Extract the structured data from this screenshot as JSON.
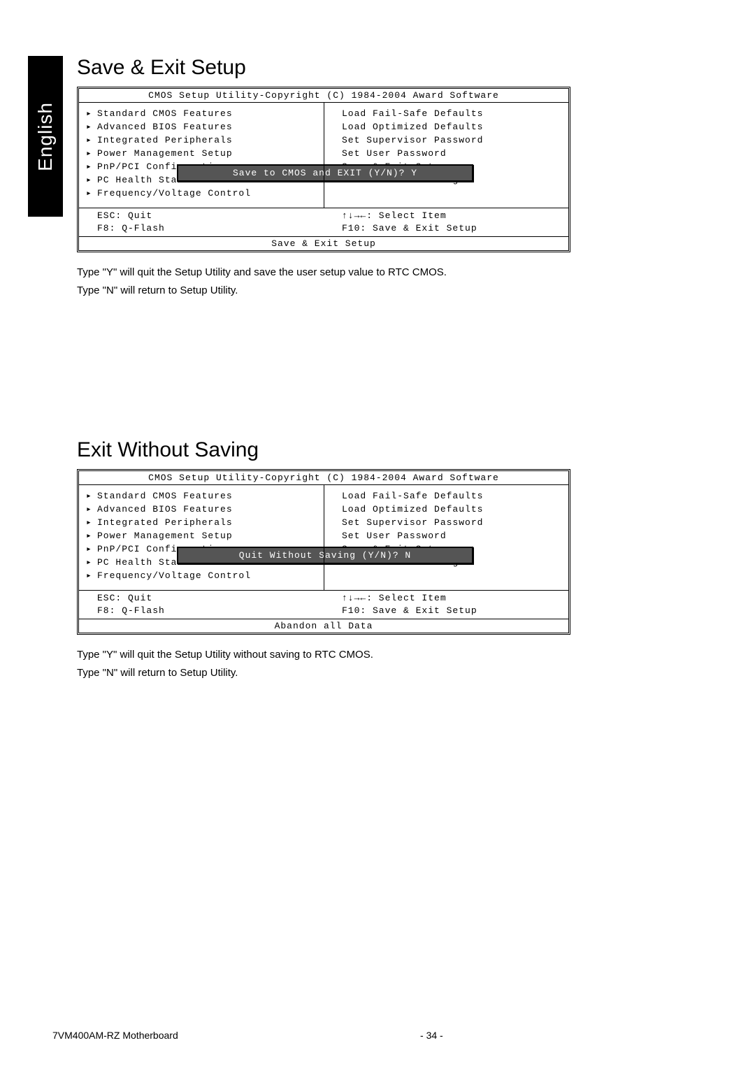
{
  "side_tab": "English",
  "section1": {
    "heading": "Save & Exit Setup",
    "bios_title": "CMOS Setup Utility-Copyright (C) 1984-2004 Award Software",
    "left_items": [
      "Standard CMOS Features",
      "Advanced BIOS Features",
      "Integrated Peripherals",
      "Power Management Setup",
      "PnP/PCI Configurations",
      "PC Health Status",
      "Frequency/Voltage Control"
    ],
    "right_items": [
      "Load Fail-Safe Defaults",
      "Load Optimized Defaults",
      "Set Supervisor Password",
      "Set User Password",
      "Save & Exit Setup",
      "Exit Without Saving"
    ],
    "dialog": "Save to CMOS and EXIT (Y/N)? Y",
    "bottom_left": [
      "ESC: Quit",
      "F8: Q-Flash"
    ],
    "bottom_right": [
      "↑↓→←: Select Item",
      "F10: Save & Exit Setup"
    ],
    "status": "Save & Exit Setup",
    "desc1": "Type \"Y\" will quit the Setup Utility and save the user setup value to RTC CMOS.",
    "desc2": "Type \"N\" will return to Setup Utility."
  },
  "section2": {
    "heading": "Exit Without Saving",
    "bios_title": "CMOS Setup Utility-Copyright (C) 1984-2004 Award Software",
    "left_items": [
      "Standard CMOS Features",
      "Advanced BIOS Features",
      "Integrated Peripherals",
      "Power Management Setup",
      "PnP/PCI Configurations",
      "PC Health Status",
      "Frequency/Voltage Control"
    ],
    "right_items": [
      "Load Fail-Safe Defaults",
      "Load Optimized Defaults",
      "Set Supervisor Password",
      "Set User Password",
      "Save & Exit Setup",
      "Exit Without Saving"
    ],
    "dialog": "Quit Without Saving (Y/N)? N",
    "bottom_left": [
      "ESC: Quit",
      "F8: Q-Flash"
    ],
    "bottom_right": [
      "↑↓→←: Select Item",
      "F10: Save & Exit Setup"
    ],
    "status": "Abandon all Data",
    "desc1": "Type \"Y\" will quit the Setup Utility without saving to RTC CMOS.",
    "desc2": "Type \"N\" will return to Setup Utility."
  },
  "footer": {
    "left": "7VM400AM-RZ Motherboard",
    "center": "- 34 -"
  }
}
